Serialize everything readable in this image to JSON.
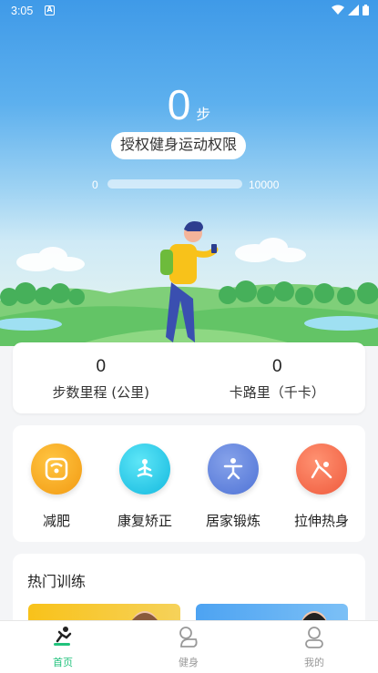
{
  "status_bar": {
    "time": "3:05",
    "notif_letter": "A"
  },
  "hero": {
    "steps_value": "0",
    "steps_unit": "步",
    "auth_button": "授权健身运动权限",
    "progress": {
      "min_label": "0",
      "max_label": "10000",
      "fraction": 0.0
    }
  },
  "stats": [
    {
      "value": "0",
      "label": "步数里程 (公里)"
    },
    {
      "value": "0",
      "label": "卡路里（千卡）"
    }
  ],
  "categories": [
    {
      "label": "减肥",
      "icon": "scale-icon",
      "color": "#f7a21b"
    },
    {
      "label": "康复矫正",
      "icon": "meditation-icon",
      "color": "#23c6e6"
    },
    {
      "label": "居家锻炼",
      "icon": "exercise-icon",
      "color": "#5f83dc"
    },
    {
      "label": "拉伸热身",
      "icon": "stretch-icon",
      "color": "#f2694a"
    }
  ],
  "hot_training": {
    "title": "热门训练"
  },
  "bottom_nav": [
    {
      "label": "首页",
      "icon": "home-runner-icon",
      "active": true
    },
    {
      "label": "健身",
      "icon": "fitness-icon",
      "active": false
    },
    {
      "label": "我的",
      "icon": "profile-icon",
      "active": false
    }
  ],
  "colors": {
    "accent": "#21c27c",
    "sky": "#3f9ae8"
  }
}
